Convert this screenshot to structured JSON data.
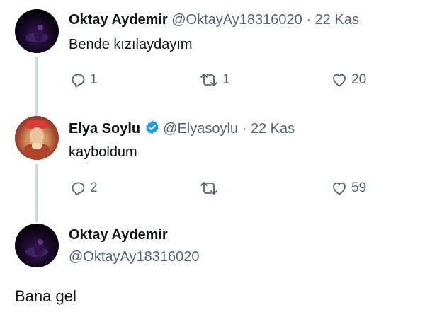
{
  "tweets": [
    {
      "name": "Oktay Aydemir",
      "handle": "@OktayAy18316020",
      "separator": "·",
      "date": "22 Kas",
      "text": "Bende kızılaydayım",
      "replies": "1",
      "retweets": "1",
      "likes": "20"
    },
    {
      "name": "Elya Soylu",
      "handle": "@Elyasoylu",
      "separator": "·",
      "date": "22 Kas",
      "verified": true,
      "text": "kayboldum",
      "replies": "2",
      "retweets": "",
      "likes": "59"
    }
  ],
  "main_tweet": {
    "name": "Oktay Aydemir",
    "handle": "@OktayAy18316020",
    "text": "Bana gel"
  },
  "colors": {
    "text": "#0f1419",
    "muted": "#536471",
    "thread_line": "#cfd9de",
    "verified_badge": "#1d9bf0"
  },
  "icons": [
    "reply-icon",
    "retweet-icon",
    "like-icon",
    "verified-badge-icon"
  ]
}
